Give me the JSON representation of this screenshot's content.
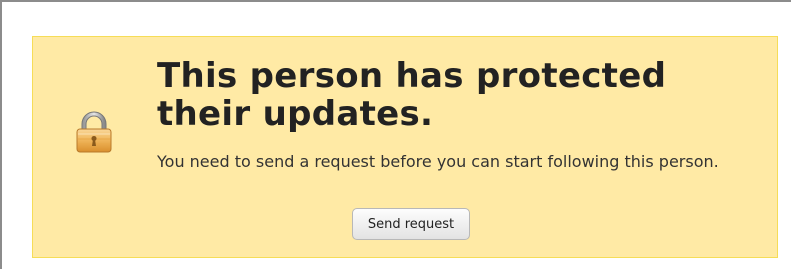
{
  "notice": {
    "icon": "lock-icon",
    "heading": "This person has protected their updates.",
    "message": "You need to send a request before you can start following this person.",
    "send_request_label": "Send request",
    "colors": {
      "background": "#ffeaa5",
      "border": "#f6dd57",
      "text": "#222222"
    }
  }
}
